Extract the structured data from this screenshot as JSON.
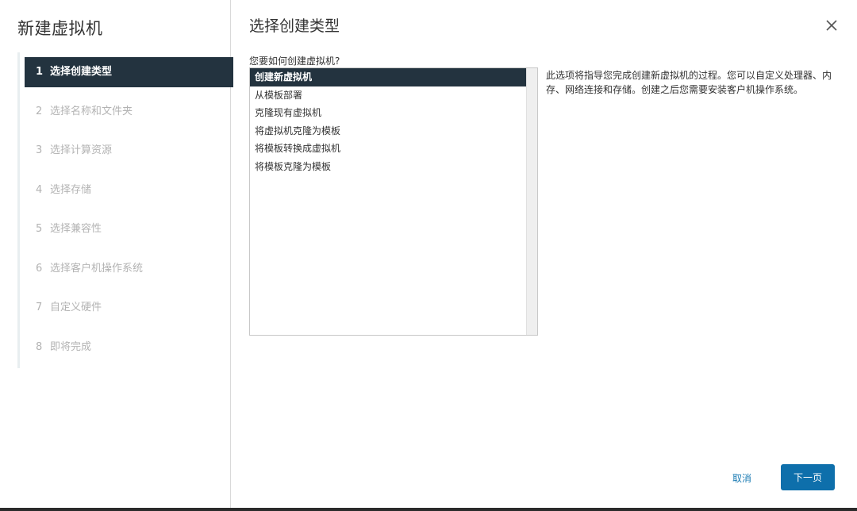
{
  "sidebar": {
    "title": "新建虚拟机",
    "steps": [
      {
        "num": "1",
        "label": "选择创建类型"
      },
      {
        "num": "2",
        "label": "选择名称和文件夹"
      },
      {
        "num": "3",
        "label": "选择计算资源"
      },
      {
        "num": "4",
        "label": "选择存储"
      },
      {
        "num": "5",
        "label": "选择兼容性"
      },
      {
        "num": "6",
        "label": "选择客户机操作系统"
      },
      {
        "num": "7",
        "label": "自定义硬件"
      },
      {
        "num": "8",
        "label": "即将完成"
      }
    ]
  },
  "main": {
    "title": "选择创建类型",
    "question": "您要如何创建虚拟机?",
    "options": [
      "创建新虚拟机",
      "从模板部署",
      "克隆现有虚拟机",
      "将虚拟机克隆为模板",
      "将模板转换成虚拟机",
      "将模板克隆为模板"
    ],
    "description": "此选项将指导您完成创建新虚拟机的过程。您可以自定义处理器、内存、网络连接和存储。创建之后您需要安装客户机操作系统。"
  },
  "footer": {
    "cancel_label": "取消",
    "next_label": "下一页"
  },
  "icons": {
    "close": "close-icon"
  },
  "colors": {
    "selected_bg": "#23333f",
    "primary_button": "#0e6fab",
    "link": "#1a7bb3"
  }
}
